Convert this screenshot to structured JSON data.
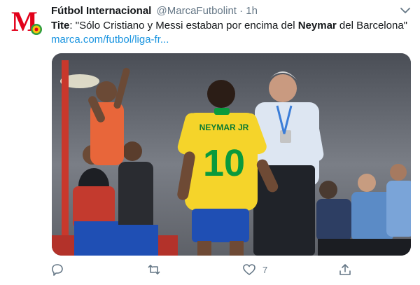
{
  "tweet": {
    "display_name": "Fútbol Internacional",
    "handle": "@MarcaFutbolint",
    "separator": "·",
    "time": "1h",
    "text": {
      "prefix": "Tite",
      "part1": ": \"Sólo Cristiano y Messi estaban por encima del ",
      "bold": "Neymar",
      "part2": " del Barcelona\""
    },
    "link": "marca.com/futbol/liga-fr...",
    "avatar_letter": "M",
    "jersey": {
      "name": "NEYMAR JR",
      "number": "10"
    },
    "actions": {
      "reply_icon": "reply-icon",
      "retweet_icon": "retweet-icon",
      "like_icon": "heart-icon",
      "like_count": "7",
      "share_icon": "share-icon"
    }
  },
  "colors": {
    "link": "#1b95e0",
    "secondary_text": "#657786",
    "avatar_red": "#e2001a",
    "jersey_yellow": "#f5d42a",
    "jersey_green": "#0a9a3c",
    "shorts_blue": "#1f4fb4"
  }
}
